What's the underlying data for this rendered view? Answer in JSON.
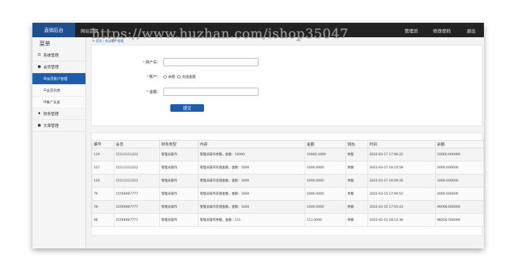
{
  "topbar": {
    "brand": "直销后台",
    "nav_home": "网站首页",
    "user": "管理员",
    "change_password": "修改密码",
    "logout": "退出"
  },
  "watermark": "https://www.huzhan.com/ishop35047",
  "sidebar": {
    "title": "菜单",
    "items": [
      {
        "label": "系统管理",
        "icon": "list-icon"
      },
      {
        "label": "会员管理",
        "icon": "user-icon"
      },
      {
        "label": "会员账户管理",
        "icon": "bank-icon",
        "sub": true,
        "active": true
      },
      {
        "label": "会员列表",
        "icon": "list-icon",
        "sub": true
      },
      {
        "label": "推广关系",
        "icon": "sitemap-icon",
        "sub": true
      },
      {
        "label": "财务管理",
        "icon": "fire-icon"
      },
      {
        "label": "文章管理",
        "icon": "user-icon"
      }
    ]
  },
  "breadcrumb": "首页 / 会员账户管理",
  "form": {
    "username_label": "用户名：",
    "account_label": "账户：",
    "account_options": [
      "余额",
      "充值金额"
    ],
    "amount_label": "金额：",
    "submit_label": "提交"
  },
  "table": {
    "headers": [
      "编号",
      "会员",
      "财务类型",
      "内容",
      "金额",
      "钱包",
      "时间",
      "余额"
    ],
    "rows": [
      [
        "129",
        "15111111222",
        "管理员操作",
        "管理员操作余额，金额：10000",
        "10000.0000",
        "余额",
        "2022-03-17 17:06:22",
        "10000.000000"
      ],
      [
        "127",
        "15111111222",
        "管理员操作",
        "管理员操作充值金额，金额：1000",
        "1000.0000",
        "余额",
        "2022-03-17 16:15:58",
        "2000.000000"
      ],
      [
        "126",
        "15111111222",
        "管理员操作",
        "管理员操作充值金额，金额：1000",
        "1000.0000",
        "余额",
        "2022-03-17 16:09:26",
        "1000.000000"
      ],
      [
        "79",
        "15566667777",
        "管理员操作",
        "管理员操作充值金额，金额：1000",
        "1000.0000",
        "余额",
        "2022-03-15 17:06:52",
        "4000.000000"
      ],
      [
        "78",
        "15566667777",
        "管理员操作",
        "管理员操作充值金额，金额：1000",
        "1000.0000",
        "余额",
        "2022-03-15 17:05:43",
        "99068.000000"
      ],
      [
        "68",
        "15566667777",
        "管理员操作",
        "管理员操作余额，金额：111",
        "111.0000",
        "余额",
        "2022-02-21 18:12:36",
        "98258.500000"
      ]
    ]
  },
  "colors": {
    "topbar": "#222222",
    "accent": "#1e5cad",
    "brand_bg": "#1d4f8f"
  }
}
